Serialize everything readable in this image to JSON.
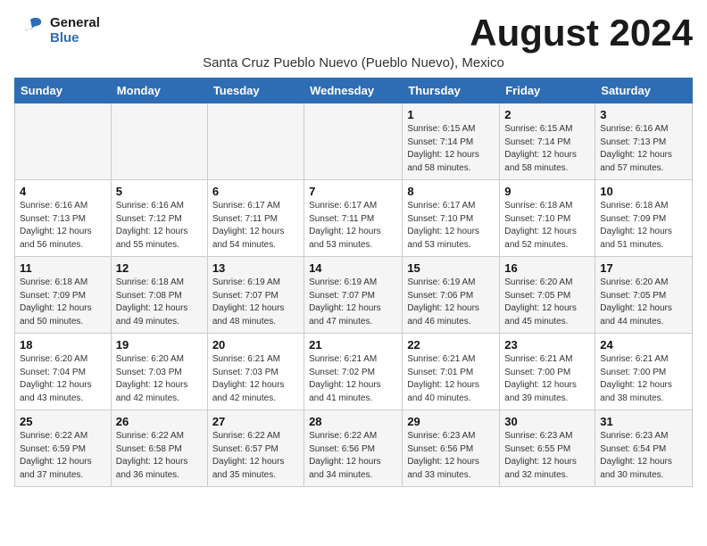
{
  "header": {
    "logo_line1": "General",
    "logo_line2": "Blue",
    "month_title": "August 2024",
    "subtitle": "Santa Cruz Pueblo Nuevo (Pueblo Nuevo), Mexico"
  },
  "days_of_week": [
    "Sunday",
    "Monday",
    "Tuesday",
    "Wednesday",
    "Thursday",
    "Friday",
    "Saturday"
  ],
  "weeks": [
    [
      {
        "day": "",
        "info": ""
      },
      {
        "day": "",
        "info": ""
      },
      {
        "day": "",
        "info": ""
      },
      {
        "day": "",
        "info": ""
      },
      {
        "day": "1",
        "info": "Sunrise: 6:15 AM\nSunset: 7:14 PM\nDaylight: 12 hours\nand 58 minutes."
      },
      {
        "day": "2",
        "info": "Sunrise: 6:15 AM\nSunset: 7:14 PM\nDaylight: 12 hours\nand 58 minutes."
      },
      {
        "day": "3",
        "info": "Sunrise: 6:16 AM\nSunset: 7:13 PM\nDaylight: 12 hours\nand 57 minutes."
      }
    ],
    [
      {
        "day": "4",
        "info": "Sunrise: 6:16 AM\nSunset: 7:13 PM\nDaylight: 12 hours\nand 56 minutes."
      },
      {
        "day": "5",
        "info": "Sunrise: 6:16 AM\nSunset: 7:12 PM\nDaylight: 12 hours\nand 55 minutes."
      },
      {
        "day": "6",
        "info": "Sunrise: 6:17 AM\nSunset: 7:11 PM\nDaylight: 12 hours\nand 54 minutes."
      },
      {
        "day": "7",
        "info": "Sunrise: 6:17 AM\nSunset: 7:11 PM\nDaylight: 12 hours\nand 53 minutes."
      },
      {
        "day": "8",
        "info": "Sunrise: 6:17 AM\nSunset: 7:10 PM\nDaylight: 12 hours\nand 53 minutes."
      },
      {
        "day": "9",
        "info": "Sunrise: 6:18 AM\nSunset: 7:10 PM\nDaylight: 12 hours\nand 52 minutes."
      },
      {
        "day": "10",
        "info": "Sunrise: 6:18 AM\nSunset: 7:09 PM\nDaylight: 12 hours\nand 51 minutes."
      }
    ],
    [
      {
        "day": "11",
        "info": "Sunrise: 6:18 AM\nSunset: 7:09 PM\nDaylight: 12 hours\nand 50 minutes."
      },
      {
        "day": "12",
        "info": "Sunrise: 6:18 AM\nSunset: 7:08 PM\nDaylight: 12 hours\nand 49 minutes."
      },
      {
        "day": "13",
        "info": "Sunrise: 6:19 AM\nSunset: 7:07 PM\nDaylight: 12 hours\nand 48 minutes."
      },
      {
        "day": "14",
        "info": "Sunrise: 6:19 AM\nSunset: 7:07 PM\nDaylight: 12 hours\nand 47 minutes."
      },
      {
        "day": "15",
        "info": "Sunrise: 6:19 AM\nSunset: 7:06 PM\nDaylight: 12 hours\nand 46 minutes."
      },
      {
        "day": "16",
        "info": "Sunrise: 6:20 AM\nSunset: 7:05 PM\nDaylight: 12 hours\nand 45 minutes."
      },
      {
        "day": "17",
        "info": "Sunrise: 6:20 AM\nSunset: 7:05 PM\nDaylight: 12 hours\nand 44 minutes."
      }
    ],
    [
      {
        "day": "18",
        "info": "Sunrise: 6:20 AM\nSunset: 7:04 PM\nDaylight: 12 hours\nand 43 minutes."
      },
      {
        "day": "19",
        "info": "Sunrise: 6:20 AM\nSunset: 7:03 PM\nDaylight: 12 hours\nand 42 minutes."
      },
      {
        "day": "20",
        "info": "Sunrise: 6:21 AM\nSunset: 7:03 PM\nDaylight: 12 hours\nand 42 minutes."
      },
      {
        "day": "21",
        "info": "Sunrise: 6:21 AM\nSunset: 7:02 PM\nDaylight: 12 hours\nand 41 minutes."
      },
      {
        "day": "22",
        "info": "Sunrise: 6:21 AM\nSunset: 7:01 PM\nDaylight: 12 hours\nand 40 minutes."
      },
      {
        "day": "23",
        "info": "Sunrise: 6:21 AM\nSunset: 7:00 PM\nDaylight: 12 hours\nand 39 minutes."
      },
      {
        "day": "24",
        "info": "Sunrise: 6:21 AM\nSunset: 7:00 PM\nDaylight: 12 hours\nand 38 minutes."
      }
    ],
    [
      {
        "day": "25",
        "info": "Sunrise: 6:22 AM\nSunset: 6:59 PM\nDaylight: 12 hours\nand 37 minutes."
      },
      {
        "day": "26",
        "info": "Sunrise: 6:22 AM\nSunset: 6:58 PM\nDaylight: 12 hours\nand 36 minutes."
      },
      {
        "day": "27",
        "info": "Sunrise: 6:22 AM\nSunset: 6:57 PM\nDaylight: 12 hours\nand 35 minutes."
      },
      {
        "day": "28",
        "info": "Sunrise: 6:22 AM\nSunset: 6:56 PM\nDaylight: 12 hours\nand 34 minutes."
      },
      {
        "day": "29",
        "info": "Sunrise: 6:23 AM\nSunset: 6:56 PM\nDaylight: 12 hours\nand 33 minutes."
      },
      {
        "day": "30",
        "info": "Sunrise: 6:23 AM\nSunset: 6:55 PM\nDaylight: 12 hours\nand 32 minutes."
      },
      {
        "day": "31",
        "info": "Sunrise: 6:23 AM\nSunset: 6:54 PM\nDaylight: 12 hours\nand 30 minutes."
      }
    ]
  ]
}
